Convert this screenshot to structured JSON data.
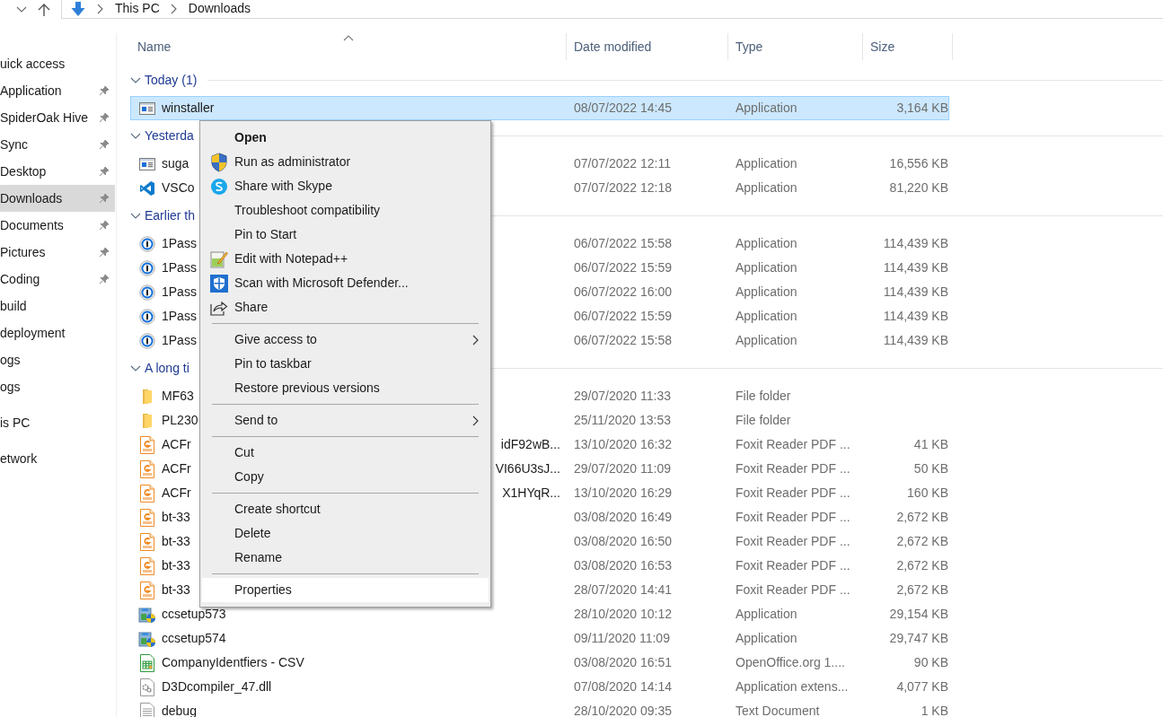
{
  "address_bar": {
    "path": [
      "This PC",
      "Downloads"
    ]
  },
  "sidebar": {
    "sections": [
      {
        "items": [
          {
            "label": "uick access",
            "pinned": false,
            "selected": false
          },
          {
            "label": "Application",
            "pinned": true,
            "selected": false
          },
          {
            "label": "SpiderOak Hive",
            "pinned": true,
            "selected": false
          },
          {
            "label": "Sync",
            "pinned": true,
            "selected": false
          },
          {
            "label": "Desktop",
            "pinned": true,
            "selected": false
          },
          {
            "label": "Downloads",
            "pinned": true,
            "selected": true
          },
          {
            "label": "Documents",
            "pinned": true,
            "selected": false
          },
          {
            "label": "Pictures",
            "pinned": true,
            "selected": false
          },
          {
            "label": "Coding",
            "pinned": true,
            "selected": false
          },
          {
            "label": "build",
            "pinned": false,
            "selected": false
          },
          {
            "label": "deployment",
            "pinned": false,
            "selected": false
          },
          {
            "label": "ogs",
            "pinned": false,
            "selected": false
          },
          {
            "label": "ogs",
            "pinned": false,
            "selected": false
          }
        ]
      },
      {
        "items": [
          {
            "label": "is PC",
            "pinned": false,
            "selected": false
          }
        ]
      },
      {
        "items": [
          {
            "label": "etwork",
            "pinned": false,
            "selected": false
          }
        ]
      }
    ]
  },
  "columns": [
    "Name",
    "Date modified",
    "Type",
    "Size"
  ],
  "groups": [
    {
      "label": "Today (1)",
      "files": [
        {
          "kind": "app",
          "name": "winstaller",
          "date": "08/07/2022 14:45",
          "type": "Application",
          "size": "3,164 KB",
          "selected": true
        }
      ]
    },
    {
      "label": "Yesterda",
      "files": [
        {
          "kind": "app",
          "name": "suga",
          "date": "07/07/2022 12:11",
          "type": "Application",
          "size": "16,556 KB",
          "selected": false
        },
        {
          "kind": "vscode",
          "name": "VSCo",
          "date": "07/07/2022 12:18",
          "type": "Application",
          "size": "81,220 KB",
          "selected": false
        }
      ]
    },
    {
      "label": "Earlier th",
      "files": [
        {
          "kind": "onepassword",
          "name": "1Pass",
          "date": "06/07/2022 15:58",
          "type": "Application",
          "size": "114,439 KB",
          "selected": false
        },
        {
          "kind": "onepassword",
          "name": "1Pass",
          "date": "06/07/2022 15:59",
          "type": "Application",
          "size": "114,439 KB",
          "selected": false
        },
        {
          "kind": "onepassword",
          "name": "1Pass",
          "date": "06/07/2022 16:00",
          "type": "Application",
          "size": "114,439 KB",
          "selected": false
        },
        {
          "kind": "onepassword",
          "name": "1Pass",
          "date": "06/07/2022 15:59",
          "type": "Application",
          "size": "114,439 KB",
          "selected": false
        },
        {
          "kind": "onepassword",
          "name": "1Pass",
          "date": "06/07/2022 15:58",
          "type": "Application",
          "size": "114,439 KB",
          "selected": false
        }
      ]
    },
    {
      "label": "A long ti",
      "files": [
        {
          "kind": "folder",
          "name": "MF63",
          "date": "29/07/2020 11:33",
          "type": "File folder",
          "selected": false
        },
        {
          "kind": "folder",
          "name": "PL230",
          "date": "25/11/2020 13:53",
          "type": "File folder",
          "selected": false
        },
        {
          "kind": "pdf",
          "name": "ACFr",
          "name_tail": "idF92wB...",
          "date": "13/10/2020 16:32",
          "type": "Foxit Reader PDF ...",
          "size": "41 KB",
          "selected": false
        },
        {
          "kind": "pdf",
          "name": "ACFr",
          "name_tail": "VI66U3sJ...",
          "date": "29/07/2020 11:09",
          "type": "Foxit Reader PDF ...",
          "size": "50 KB",
          "selected": false
        },
        {
          "kind": "pdf",
          "name": "ACFr",
          "name_tail": "X1HYqR...",
          "date": "13/10/2020 16:29",
          "type": "Foxit Reader PDF ...",
          "size": "160 KB",
          "selected": false
        },
        {
          "kind": "pdf",
          "name": "bt-33",
          "date": "03/08/2020 16:49",
          "type": "Foxit Reader PDF ...",
          "size": "2,672 KB",
          "selected": false
        },
        {
          "kind": "pdf",
          "name": "bt-33",
          "date": "03/08/2020 16:50",
          "type": "Foxit Reader PDF ...",
          "size": "2,672 KB",
          "selected": false
        },
        {
          "kind": "pdf",
          "name": "bt-33",
          "date": "03/08/2020 16:53",
          "type": "Foxit Reader PDF ...",
          "size": "2,672 KB",
          "selected": false
        },
        {
          "kind": "pdf",
          "name": "bt-33",
          "date": "28/07/2020 14:41",
          "type": "Foxit Reader PDF ...",
          "size": "2,672 KB",
          "selected": false
        },
        {
          "kind": "installer",
          "name": "ccsetup573",
          "date": "28/10/2020 10:12",
          "type": "Application",
          "size": "29,154 KB",
          "selected": false
        },
        {
          "kind": "installer",
          "name": "ccsetup574",
          "date": "09/11/2020 11:09",
          "type": "Application",
          "size": "29,747 KB",
          "selected": false
        },
        {
          "kind": "spreadsheet",
          "name": "CompanyIdentfiers - CSV",
          "date": "03/08/2020 16:51",
          "type": "OpenOffice.org 1....",
          "size": "90 KB",
          "selected": false
        },
        {
          "kind": "dll",
          "name": "D3Dcompiler_47.dll",
          "date": "07/08/2020 14:14",
          "type": "Application extens...",
          "size": "4,077 KB",
          "selected": false
        },
        {
          "kind": "text",
          "name": "debug",
          "date": "28/10/2020 09:35",
          "type": "Text Document",
          "size": "1 KB",
          "selected": false
        }
      ]
    }
  ],
  "context_menu": [
    {
      "kind": "item",
      "label": "Open",
      "bold": true,
      "submenu": false,
      "highlighted": false
    },
    {
      "kind": "item",
      "label": "Run as administrator",
      "bold": false,
      "submenu": false,
      "highlighted": false
    },
    {
      "kind": "item",
      "label": "Share with Skype",
      "bold": false,
      "submenu": false,
      "highlighted": false
    },
    {
      "kind": "item",
      "label": "Troubleshoot compatibility",
      "bold": false,
      "submenu": false,
      "highlighted": false
    },
    {
      "kind": "item",
      "label": "Pin to Start",
      "bold": false,
      "submenu": false,
      "highlighted": false
    },
    {
      "kind": "item",
      "label": "Edit with Notepad++",
      "bold": false,
      "submenu": false,
      "highlighted": false
    },
    {
      "kind": "item",
      "label": "Scan with Microsoft Defender...",
      "bold": false,
      "submenu": false,
      "highlighted": false
    },
    {
      "kind": "item",
      "label": "Share",
      "bold": false,
      "submenu": false,
      "highlighted": false
    },
    {
      "kind": "separator"
    },
    {
      "kind": "item",
      "label": "Give access to",
      "bold": false,
      "submenu": true,
      "highlighted": false
    },
    {
      "kind": "item",
      "label": "Pin to taskbar",
      "bold": false,
      "submenu": false,
      "highlighted": false
    },
    {
      "kind": "item",
      "label": "Restore previous versions",
      "bold": false,
      "submenu": false,
      "highlighted": false
    },
    {
      "kind": "separator"
    },
    {
      "kind": "item",
      "label": "Send to",
      "bold": false,
      "submenu": true,
      "highlighted": false
    },
    {
      "kind": "separator"
    },
    {
      "kind": "item",
      "label": "Cut",
      "bold": false,
      "submenu": false,
      "highlighted": false
    },
    {
      "kind": "item",
      "label": "Copy",
      "bold": false,
      "submenu": false,
      "highlighted": false
    },
    {
      "kind": "separator"
    },
    {
      "kind": "item",
      "label": "Create shortcut",
      "bold": false,
      "submenu": false,
      "highlighted": false
    },
    {
      "kind": "item",
      "label": "Delete",
      "bold": false,
      "submenu": false,
      "highlighted": false
    },
    {
      "kind": "item",
      "label": "Rename",
      "bold": false,
      "submenu": false,
      "highlighted": false
    },
    {
      "kind": "separator"
    },
    {
      "kind": "item",
      "label": "Properties",
      "bold": false,
      "submenu": false,
      "highlighted": true
    }
  ]
}
